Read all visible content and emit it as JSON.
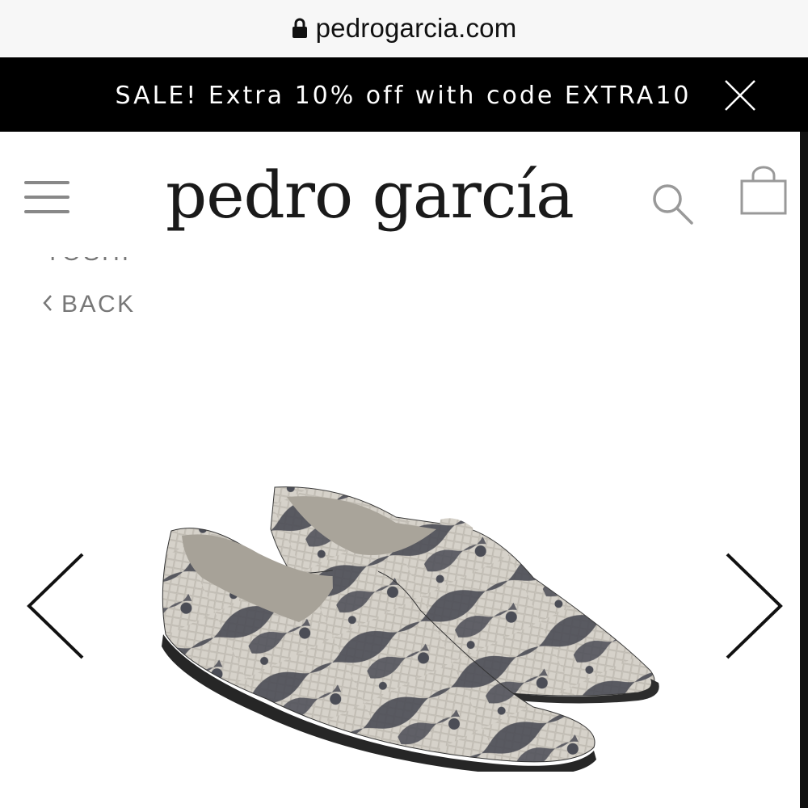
{
  "browser": {
    "url": "pedrogarcia.com",
    "lock_icon": "lock-icon"
  },
  "promo_banner": {
    "text": "SALE! Extra 10% off with code EXTRA10",
    "close_icon": "close-icon"
  },
  "header": {
    "logo_text": "pedro garcía",
    "menu_icon": "hamburger-menu-icon",
    "search_icon": "search-icon",
    "bag_icon": "shopping-bag-icon"
  },
  "breadcrumb": {
    "product_name": "TOSHI",
    "back_label": "BACK",
    "back_icon": "chevron-left-icon"
  },
  "carousel": {
    "prev_icon": "chevron-left-icon",
    "next_icon": "chevron-right-icon",
    "image_subject": "snakeskin-print loafers"
  },
  "colors": {
    "banner_bg": "#000000",
    "banner_text": "#ffffff",
    "text_gray": "#777777",
    "logo": "#1a1a1a",
    "snake_light": "#c9c5bd",
    "snake_dark": "#4b4d56"
  }
}
